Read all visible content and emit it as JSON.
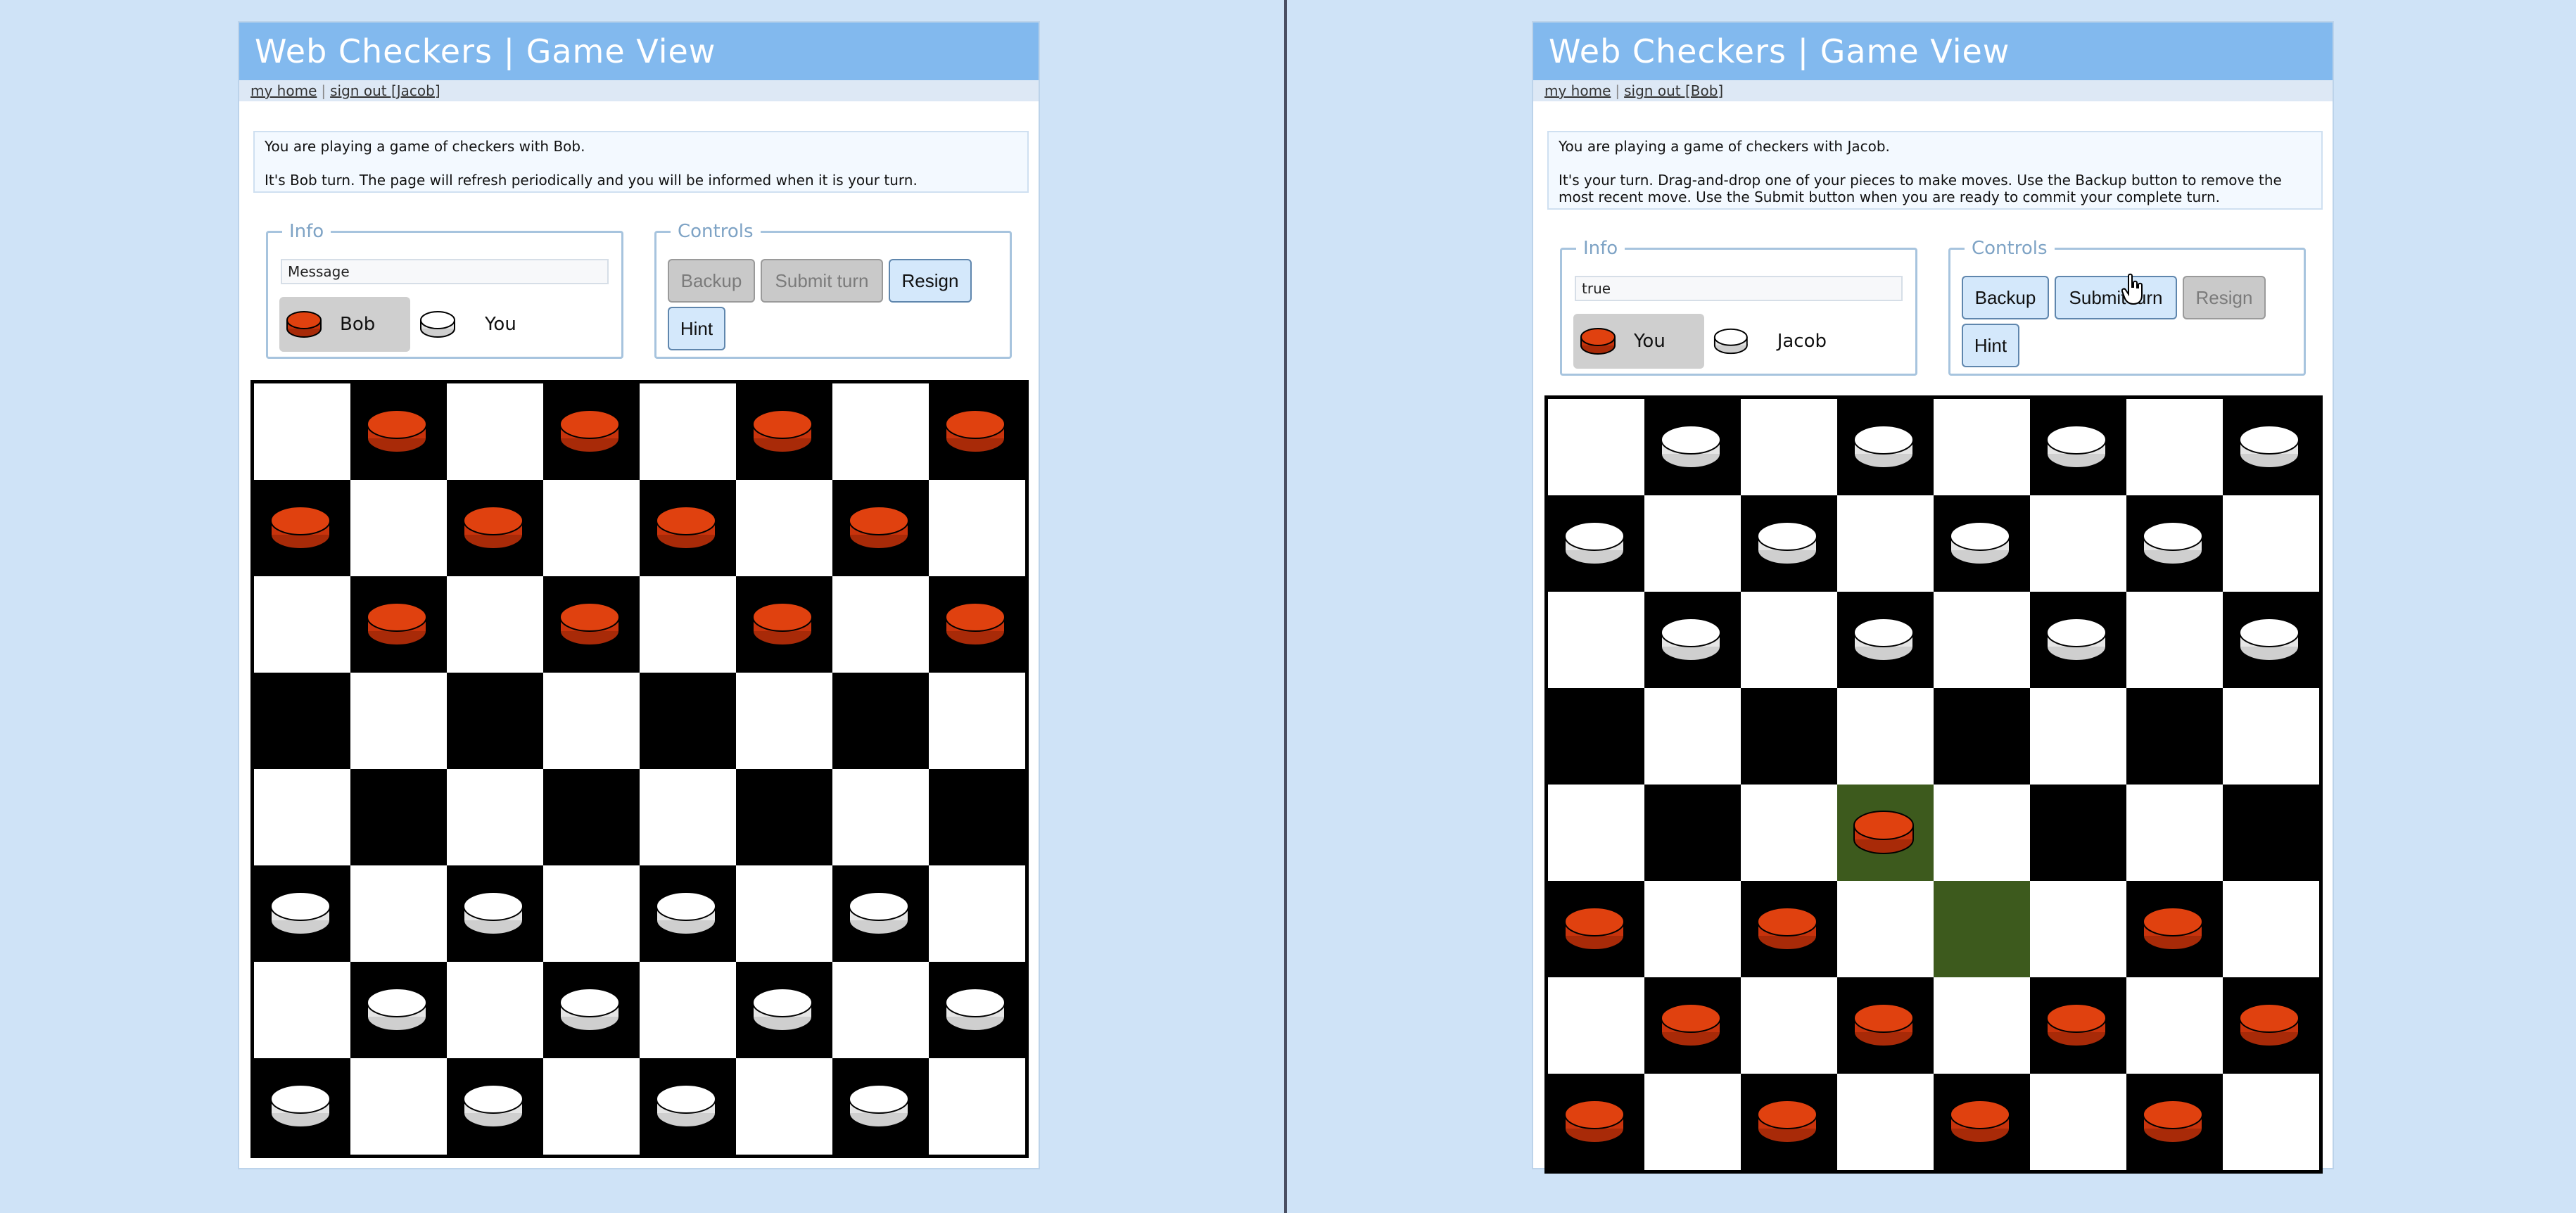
{
  "colors": {
    "page_bg": "#cfe3f7",
    "title_bar": "#82b9ee",
    "red_piece": "#d43a10",
    "white_piece": "#ffffff",
    "highlight": "#3d5a1d"
  },
  "left": {
    "title": "Web Checkers | Game View",
    "nav": {
      "home": "my home",
      "separator": "|",
      "signout": "sign out [Jacob]"
    },
    "messages": [
      "You are playing a game of checkers with Bob.",
      "It's Bob turn. The page will refresh periodically and you will be informed when it is your turn."
    ],
    "info": {
      "legend": "Info",
      "message_value": "Message",
      "player1": {
        "name": "Bob",
        "color": "red",
        "active": true
      },
      "player2": {
        "name": "You",
        "color": "white",
        "active": false
      }
    },
    "controls": {
      "legend": "Controls",
      "backup": "Backup",
      "submit": "Submit turn",
      "resign": "Resign",
      "hint": "Hint",
      "disabled": [
        "backup",
        "submit"
      ]
    },
    "board": {
      "rows": [
        ".r.r.r.r",
        "r.r.r.r.",
        ".r.r.r.r",
        "........",
        "........",
        "w.w.w.w.",
        ".w.w.w.w",
        "w.w.w.w."
      ],
      "highlight": []
    }
  },
  "right": {
    "title": "Web Checkers | Game View",
    "nav": {
      "home": "my home",
      "separator": "|",
      "signout": "sign out [Bob]"
    },
    "messages": [
      "You are playing a game of checkers with Jacob.",
      "It's your turn. Drag-and-drop one of your pieces to make moves. Use the Backup button to remove the most recent move. Use the Submit button when you are ready to commit your complete turn."
    ],
    "info": {
      "legend": "Info",
      "message_value": "true",
      "player1": {
        "name": "You",
        "color": "red",
        "active": true
      },
      "player2": {
        "name": "Jacob",
        "color": "white",
        "active": false
      }
    },
    "controls": {
      "legend": "Controls",
      "backup": "Backup",
      "submit": "Submit turn",
      "resign": "Resign",
      "hint": "Hint",
      "disabled": [
        "resign"
      ]
    },
    "board": {
      "rows": [
        ".w.w.w.w",
        "w.w.w.w.",
        ".w.w.w.w",
        "........",
        "...r....",
        "r.r...r.",
        ".r.r.r.r",
        "r.r.r.r."
      ],
      "highlight": [
        [
          4,
          3
        ],
        [
          5,
          4
        ]
      ]
    }
  }
}
